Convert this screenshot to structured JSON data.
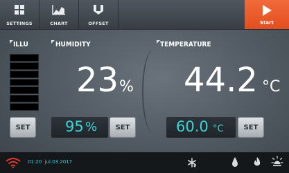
{
  "toolbar": {
    "settings_label": "SETTINGS",
    "chart_label": "CHART",
    "offset_label": "OFFSET",
    "start_label": "Start"
  },
  "illumination": {
    "label": "ILLU",
    "segments": 7,
    "level": 0
  },
  "humidity": {
    "label": "HUMIDITY",
    "value": "23",
    "unit": "%",
    "setpoint": "95",
    "setpoint_unit": "%",
    "set_label": "SET"
  },
  "temperature": {
    "label": "TEMPERATURE",
    "value": "44.2",
    "unit": "°C",
    "setpoint": "60.0",
    "setpoint_unit": "°C",
    "set_label": "SET"
  },
  "illu_set_label": "SET",
  "status": {
    "time": "01:20",
    "date": "jul.03.2017"
  },
  "colors": {
    "accent_orange": "#e9552a",
    "setpoint_cyan": "#38d6d8",
    "wifi_red": "#e3392c"
  },
  "icons": [
    "grid-icon",
    "chart-icon",
    "offset-icon",
    "play-icon",
    "wifi-icon",
    "fan-icon",
    "water-drop-icon",
    "flame-icon",
    "light-icon"
  ]
}
